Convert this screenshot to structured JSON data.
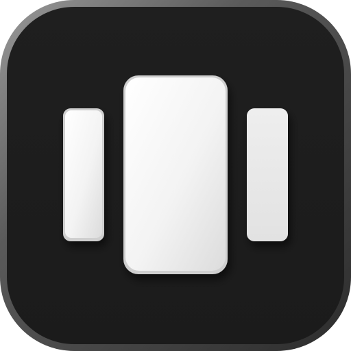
{
  "app_icon": {
    "icon": "three-panels-icon",
    "colors": {
      "bezel_outer": "#2a2a2a",
      "bezel_highlight": "#8a8a8a",
      "background": "#1e1e1e",
      "panel_light": "#f4f4f4",
      "panel_shade": "#d4d4d4",
      "panel_edge": "#bdbdbd"
    }
  }
}
